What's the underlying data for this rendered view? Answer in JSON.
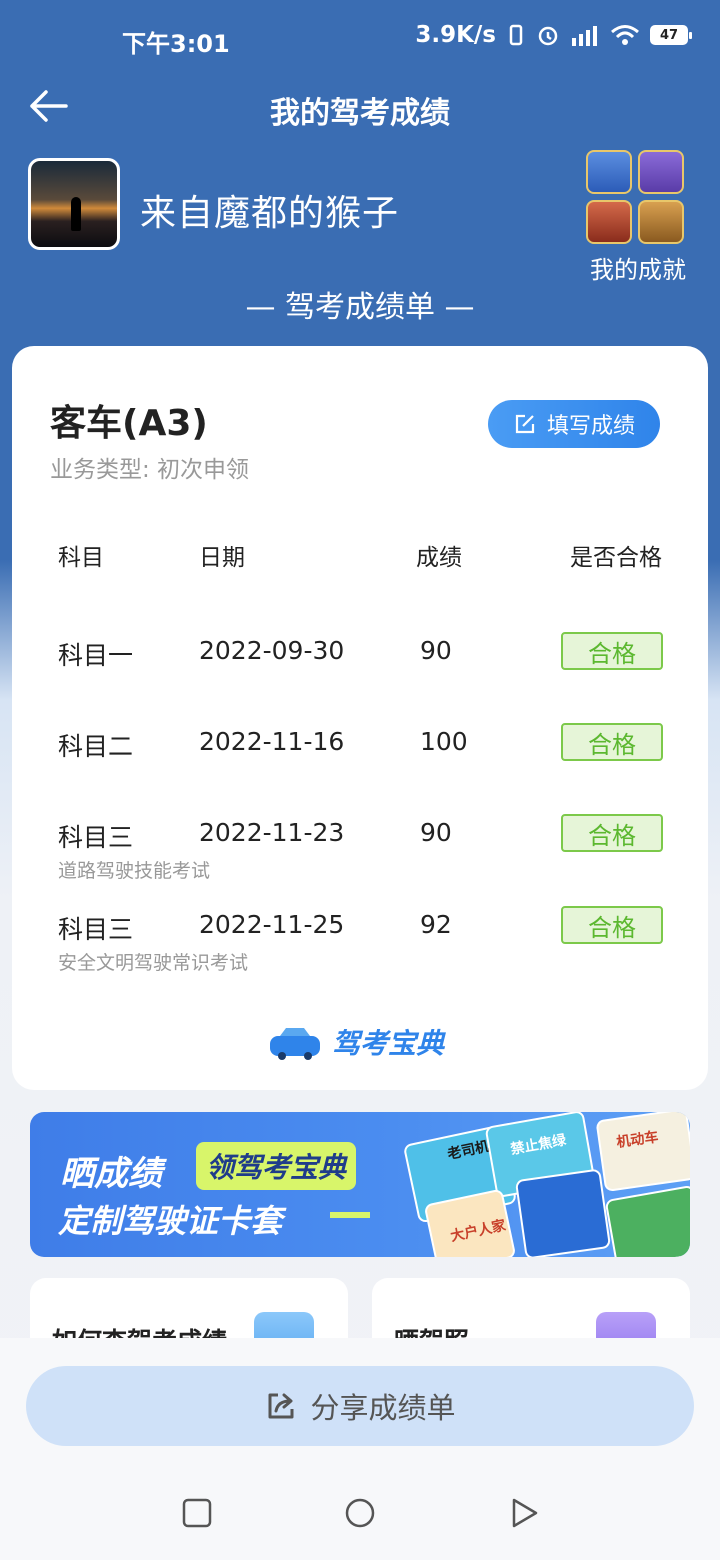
{
  "status_bar": {
    "time": "下午3:01",
    "network_speed": "3.9K/s",
    "battery": "47"
  },
  "nav": {
    "title": "我的驾考成绩"
  },
  "profile": {
    "user_name": "来自魔都的猴子",
    "achievements_label": "我的成就"
  },
  "section_header": "— 驾考成绩单 —",
  "card": {
    "license_type": "客车(A3)",
    "business_type": "业务类型: 初次申领",
    "fill_button": "填写成绩",
    "columns": [
      "科目",
      "日期",
      "成绩",
      "是否合格"
    ],
    "rows": [
      {
        "subject": "科目一",
        "date": "2022-09-30",
        "score": "90",
        "result": "合格",
        "note": ""
      },
      {
        "subject": "科目二",
        "date": "2022-11-16",
        "score": "100",
        "result": "合格",
        "note": ""
      },
      {
        "subject": "科目三",
        "date": "2022-11-23",
        "score": "90",
        "result": "合格",
        "note": "道路驾驶技能考试"
      },
      {
        "subject": "科目三",
        "date": "2022-11-25",
        "score": "92",
        "result": "合格",
        "note": "安全文明驾驶常识考试"
      }
    ],
    "brand": "驾考宝典"
  },
  "promo": {
    "title": "晒成绩",
    "tag": "领驾考宝典",
    "subtitle": "定制驾驶证卡套",
    "deco_texts": [
      "老司机",
      "禁止焦绿",
      "机动车",
      "大户人家"
    ]
  },
  "tiles": [
    {
      "title": "如何查驾考成绩"
    },
    {
      "title": "晒驾照"
    }
  ],
  "share_button": "分享成绩单",
  "colors": {
    "header_blue": "#3a6db3",
    "accent_blue": "#2f84ea",
    "pass_green": "#5cb830",
    "share_bg": "#cfe1f8"
  }
}
